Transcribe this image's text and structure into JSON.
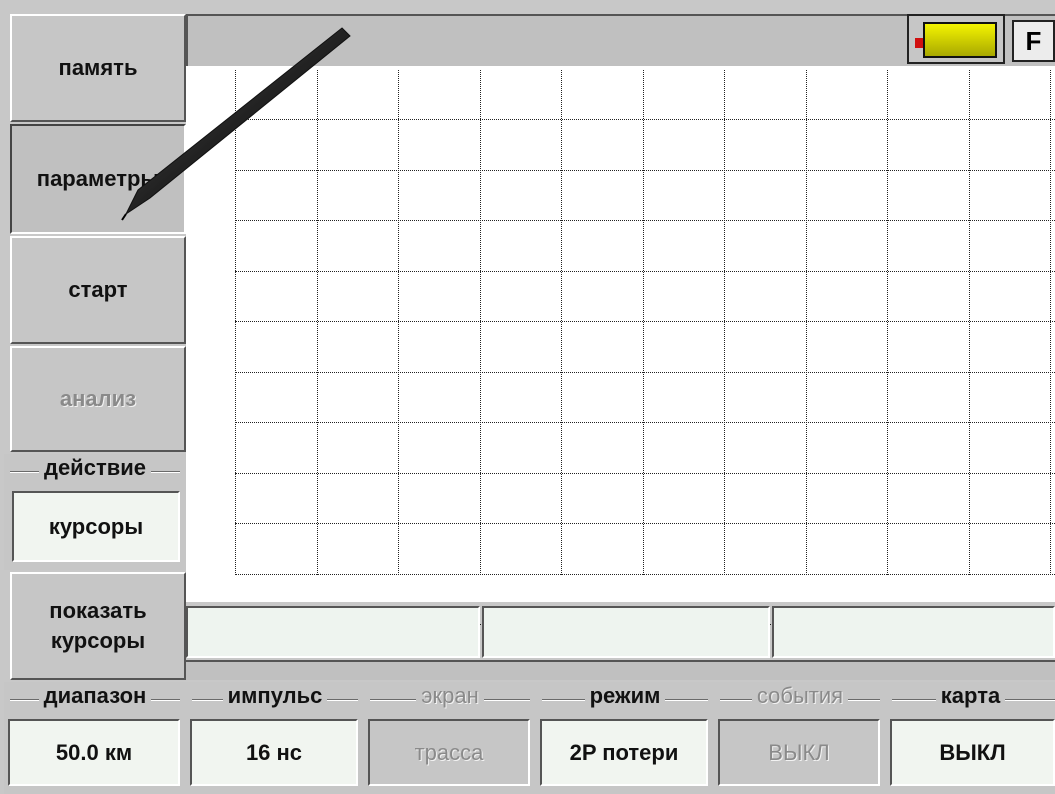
{
  "menu": {
    "memory": "память",
    "parameters": "параметры",
    "start": "старт",
    "analysis": "анализ",
    "action_group": {
      "label": "действие",
      "value": "курсоры"
    },
    "show_cursors_line1": "показать",
    "show_cursors_line2": "курсоры"
  },
  "status": {
    "f_button": "F"
  },
  "bottom": [
    {
      "label": "диапазон",
      "value": "50.0 км",
      "enabled": true
    },
    {
      "label": "импульс",
      "value": "16 нс",
      "enabled": true
    },
    {
      "label": "экран",
      "value": "трасса",
      "enabled": false
    },
    {
      "label": "режим",
      "value": "2P потери",
      "enabled": true
    },
    {
      "label": "события",
      "value": "ВЫКЛ",
      "enabled": false
    },
    {
      "label": "карта",
      "value": "ВЫКЛ",
      "enabled": true
    }
  ],
  "colors": {
    "battery": "#d8d800",
    "battery_tip": "#d01010",
    "plot_bg": "#ffffff"
  },
  "icons": {
    "stylus": "stylus-pen-icon",
    "battery": "battery-icon"
  }
}
